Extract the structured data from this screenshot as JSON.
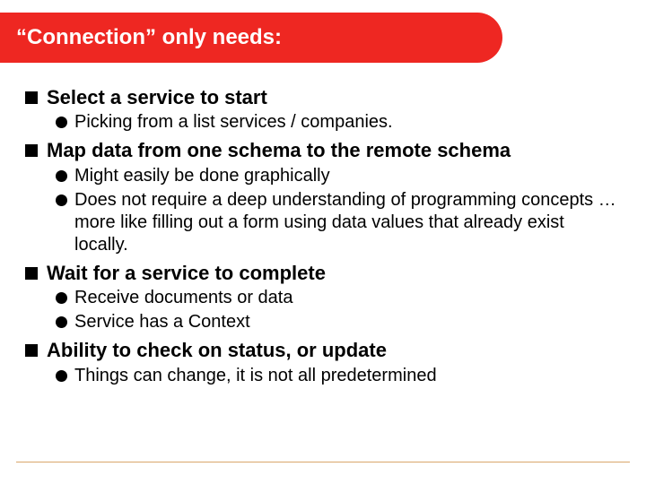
{
  "title": "“Connection” only needs:",
  "bullets": [
    {
      "text": "Select a service to start",
      "sub": [
        "Picking from a list services / companies."
      ]
    },
    {
      "text": "Map data from one schema to the remote schema",
      "sub": [
        "Might easily be done graphically",
        "Does not require a deep understanding of programming concepts … more like filling out a form using data values that already exist locally."
      ]
    },
    {
      "text": "Wait for a service to complete",
      "sub": [
        "Receive documents or data",
        "Service has a Context"
      ]
    },
    {
      "text": "Ability to check on status, or update",
      "sub": [
        "Things can change, it is not all predetermined"
      ]
    }
  ],
  "colors": {
    "accent": "#ee2722",
    "footer_rule": "#d9a76a"
  }
}
